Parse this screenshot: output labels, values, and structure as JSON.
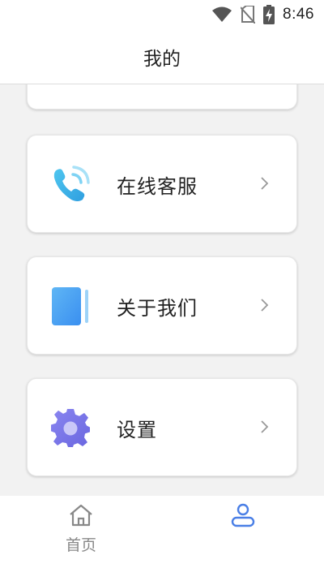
{
  "status_bar": {
    "time": "8:46",
    "icons": [
      "wifi-icon",
      "no-sim-icon",
      "battery-charging-icon"
    ]
  },
  "header": {
    "title": "我的"
  },
  "menu": {
    "items": [
      {
        "label": "在线客服",
        "icon": "phone-call-icon"
      },
      {
        "label": "关于我们",
        "icon": "book-icon"
      },
      {
        "label": "设置",
        "icon": "gear-icon"
      }
    ]
  },
  "tabbar": {
    "tabs": [
      {
        "label": "首页",
        "icon": "home-icon",
        "active": false
      },
      {
        "label": "",
        "icon": "user-icon",
        "active": true
      }
    ],
    "active_color": "#4a7fe6",
    "inactive_color": "#888888"
  }
}
